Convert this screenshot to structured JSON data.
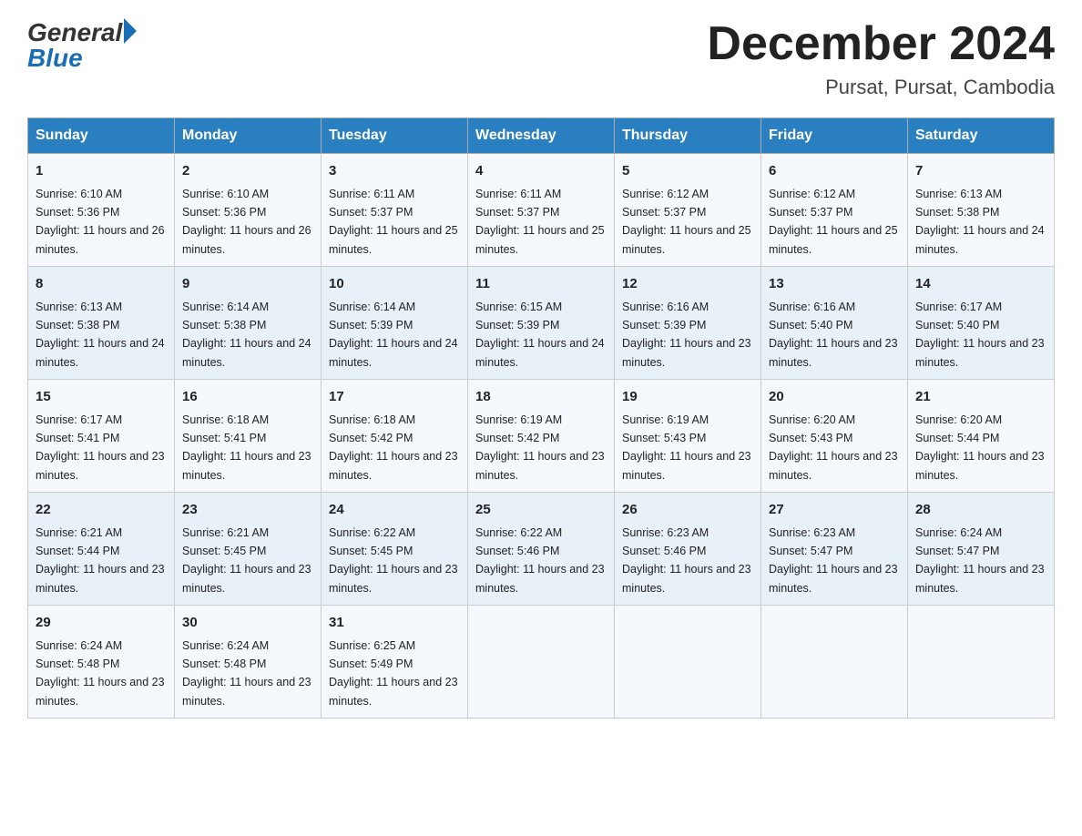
{
  "header": {
    "logo_general": "General",
    "logo_blue": "Blue",
    "title": "December 2024",
    "subtitle": "Pursat, Pursat, Cambodia"
  },
  "weekdays": [
    "Sunday",
    "Monday",
    "Tuesday",
    "Wednesday",
    "Thursday",
    "Friday",
    "Saturday"
  ],
  "weeks": [
    [
      {
        "day": "1",
        "sunrise": "6:10 AM",
        "sunset": "5:36 PM",
        "daylight": "11 hours and 26 minutes."
      },
      {
        "day": "2",
        "sunrise": "6:10 AM",
        "sunset": "5:36 PM",
        "daylight": "11 hours and 26 minutes."
      },
      {
        "day": "3",
        "sunrise": "6:11 AM",
        "sunset": "5:37 PM",
        "daylight": "11 hours and 25 minutes."
      },
      {
        "day": "4",
        "sunrise": "6:11 AM",
        "sunset": "5:37 PM",
        "daylight": "11 hours and 25 minutes."
      },
      {
        "day": "5",
        "sunrise": "6:12 AM",
        "sunset": "5:37 PM",
        "daylight": "11 hours and 25 minutes."
      },
      {
        "day": "6",
        "sunrise": "6:12 AM",
        "sunset": "5:37 PM",
        "daylight": "11 hours and 25 minutes."
      },
      {
        "day": "7",
        "sunrise": "6:13 AM",
        "sunset": "5:38 PM",
        "daylight": "11 hours and 24 minutes."
      }
    ],
    [
      {
        "day": "8",
        "sunrise": "6:13 AM",
        "sunset": "5:38 PM",
        "daylight": "11 hours and 24 minutes."
      },
      {
        "day": "9",
        "sunrise": "6:14 AM",
        "sunset": "5:38 PM",
        "daylight": "11 hours and 24 minutes."
      },
      {
        "day": "10",
        "sunrise": "6:14 AM",
        "sunset": "5:39 PM",
        "daylight": "11 hours and 24 minutes."
      },
      {
        "day": "11",
        "sunrise": "6:15 AM",
        "sunset": "5:39 PM",
        "daylight": "11 hours and 24 minutes."
      },
      {
        "day": "12",
        "sunrise": "6:16 AM",
        "sunset": "5:39 PM",
        "daylight": "11 hours and 23 minutes."
      },
      {
        "day": "13",
        "sunrise": "6:16 AM",
        "sunset": "5:40 PM",
        "daylight": "11 hours and 23 minutes."
      },
      {
        "day": "14",
        "sunrise": "6:17 AM",
        "sunset": "5:40 PM",
        "daylight": "11 hours and 23 minutes."
      }
    ],
    [
      {
        "day": "15",
        "sunrise": "6:17 AM",
        "sunset": "5:41 PM",
        "daylight": "11 hours and 23 minutes."
      },
      {
        "day": "16",
        "sunrise": "6:18 AM",
        "sunset": "5:41 PM",
        "daylight": "11 hours and 23 minutes."
      },
      {
        "day": "17",
        "sunrise": "6:18 AM",
        "sunset": "5:42 PM",
        "daylight": "11 hours and 23 minutes."
      },
      {
        "day": "18",
        "sunrise": "6:19 AM",
        "sunset": "5:42 PM",
        "daylight": "11 hours and 23 minutes."
      },
      {
        "day": "19",
        "sunrise": "6:19 AM",
        "sunset": "5:43 PM",
        "daylight": "11 hours and 23 minutes."
      },
      {
        "day": "20",
        "sunrise": "6:20 AM",
        "sunset": "5:43 PM",
        "daylight": "11 hours and 23 minutes."
      },
      {
        "day": "21",
        "sunrise": "6:20 AM",
        "sunset": "5:44 PM",
        "daylight": "11 hours and 23 minutes."
      }
    ],
    [
      {
        "day": "22",
        "sunrise": "6:21 AM",
        "sunset": "5:44 PM",
        "daylight": "11 hours and 23 minutes."
      },
      {
        "day": "23",
        "sunrise": "6:21 AM",
        "sunset": "5:45 PM",
        "daylight": "11 hours and 23 minutes."
      },
      {
        "day": "24",
        "sunrise": "6:22 AM",
        "sunset": "5:45 PM",
        "daylight": "11 hours and 23 minutes."
      },
      {
        "day": "25",
        "sunrise": "6:22 AM",
        "sunset": "5:46 PM",
        "daylight": "11 hours and 23 minutes."
      },
      {
        "day": "26",
        "sunrise": "6:23 AM",
        "sunset": "5:46 PM",
        "daylight": "11 hours and 23 minutes."
      },
      {
        "day": "27",
        "sunrise": "6:23 AM",
        "sunset": "5:47 PM",
        "daylight": "11 hours and 23 minutes."
      },
      {
        "day": "28",
        "sunrise": "6:24 AM",
        "sunset": "5:47 PM",
        "daylight": "11 hours and 23 minutes."
      }
    ],
    [
      {
        "day": "29",
        "sunrise": "6:24 AM",
        "sunset": "5:48 PM",
        "daylight": "11 hours and 23 minutes."
      },
      {
        "day": "30",
        "sunrise": "6:24 AM",
        "sunset": "5:48 PM",
        "daylight": "11 hours and 23 minutes."
      },
      {
        "day": "31",
        "sunrise": "6:25 AM",
        "sunset": "5:49 PM",
        "daylight": "11 hours and 23 minutes."
      },
      null,
      null,
      null,
      null
    ]
  ]
}
